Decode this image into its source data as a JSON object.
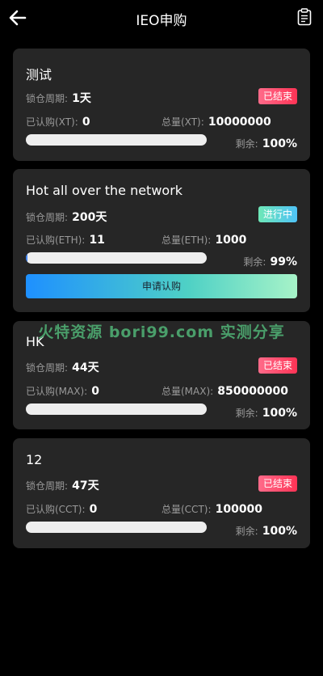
{
  "header": {
    "title": "IEO申购",
    "back_icon": "back-arrow-icon",
    "clipboard_icon": "clipboard-icon"
  },
  "labels": {
    "lock_period": "锁仓周期:",
    "remaining": "剩余:"
  },
  "cards": [
    {
      "name": "测试",
      "lock_period": "1天",
      "status": "已结束",
      "subscribed_label": "已认购(XT):",
      "subscribed_value": "0",
      "total_label": "总量(XT):",
      "total_value": "10000000",
      "remaining": "100%",
      "progress": 0
    },
    {
      "name": "Hot all over the network",
      "lock_period": "200天",
      "status": "进行中",
      "subscribed_label": "已认购(ETH):",
      "subscribed_value": "11",
      "total_label": "总量(ETH):",
      "total_value": "1000",
      "remaining": "99%",
      "progress": 0.01,
      "button": "申请认购"
    },
    {
      "name": "HK",
      "lock_period": "44天",
      "status": "已结束",
      "subscribed_label": "已认购(MAX):",
      "subscribed_value": "0",
      "total_label": "总量(MAX):",
      "total_value": "850000000",
      "remaining": "100%",
      "progress": 0
    },
    {
      "name": "12",
      "lock_period": "47天",
      "status": "已结束",
      "subscribed_label": "已认购(CCT):",
      "subscribed_value": "0",
      "total_label": "总量(CCT):",
      "total_value": "100000",
      "remaining": "100%",
      "progress": 0
    }
  ],
  "watermark": "火特资源 bori99.com 实测分享",
  "colors": {
    "ended_badge": "#ff3355",
    "active_badge": "#4fc3f7",
    "card_bg": "#262626"
  }
}
